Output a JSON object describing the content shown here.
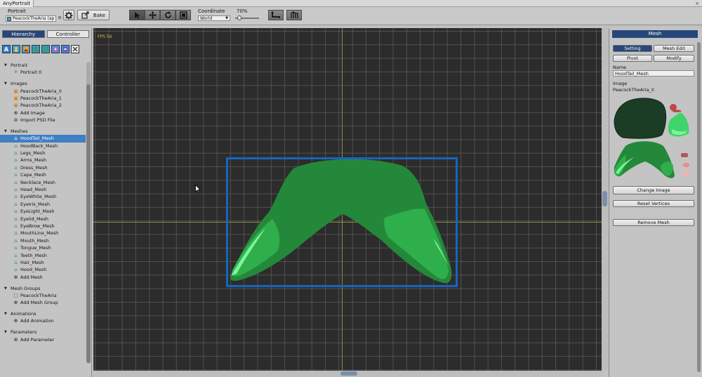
{
  "window": {
    "tab_title": "AnyPortrait",
    "close_label": "×"
  },
  "toolbar": {
    "portrait_label": "Portrait",
    "portrait_value": "PeacockTheAria (ap",
    "portrait_dot": "o",
    "bake_label": "Bake",
    "coordinate_label": "Coordinate",
    "coordinate_value": "World",
    "zoom_label": "70%",
    "zoom_value": 0.7
  },
  "left_panel": {
    "tabs": [
      "Hierarchy",
      "Controller"
    ],
    "filter_icons": [
      "text-filter-icon",
      "bone-filter-icon",
      "image-filter-icon",
      "mesh-filter-icon",
      "meshgroup-filter-icon",
      "animation-filter-icon",
      "param-filter-icon",
      "close-filter-icon"
    ],
    "sections": [
      {
        "title": "Portrait",
        "items": [
          {
            "label": "Portrait 0",
            "icon": "portrait-icon"
          }
        ]
      },
      {
        "title": "Images",
        "items": [
          {
            "label": "PeacockTheAria_0",
            "icon": "image-icon"
          },
          {
            "label": "PeacockTheAria_1",
            "icon": "image-icon"
          },
          {
            "label": "PeacockTheAria_2",
            "icon": "image-icon"
          },
          {
            "label": "Add Image",
            "icon": "add-icon"
          },
          {
            "label": "Import PSD File",
            "icon": "import-icon"
          }
        ]
      },
      {
        "title": "Meshes",
        "items": [
          {
            "label": "HoodTail_Mesh",
            "icon": "mesh-icon",
            "selected": true
          },
          {
            "label": "HoodBack_Mesh",
            "icon": "mesh-icon"
          },
          {
            "label": "Legs_Mesh",
            "icon": "mesh-icon"
          },
          {
            "label": "Arms_Mesh",
            "icon": "mesh-icon"
          },
          {
            "label": "Dress_Mesh",
            "icon": "mesh-icon"
          },
          {
            "label": "Cape_Mesh",
            "icon": "mesh-icon"
          },
          {
            "label": "Necklace_Mesh",
            "icon": "mesh-icon"
          },
          {
            "label": "Head_Mesh",
            "icon": "mesh-icon"
          },
          {
            "label": "EyeWhite_Mesh",
            "icon": "mesh-icon"
          },
          {
            "label": "EyeIris_Mesh",
            "icon": "mesh-icon"
          },
          {
            "label": "EyeLight_Mesh",
            "icon": "mesh-icon"
          },
          {
            "label": "Eyelid_Mesh",
            "icon": "mesh-icon"
          },
          {
            "label": "EyeBrow_Mesh",
            "icon": "mesh-icon"
          },
          {
            "label": "MouthLine_Mesh",
            "icon": "mesh-icon"
          },
          {
            "label": "Mouth_Mesh",
            "icon": "mesh-icon"
          },
          {
            "label": "Tongue_Mesh",
            "icon": "mesh-icon"
          },
          {
            "label": "Teeth_Mesh",
            "icon": "mesh-icon"
          },
          {
            "label": "Hair_Mesh",
            "icon": "mesh-icon"
          },
          {
            "label": "Hood_Mesh",
            "icon": "mesh-icon"
          },
          {
            "label": "Add Mesh",
            "icon": "add-icon"
          }
        ]
      },
      {
        "title": "Mesh Groups",
        "items": [
          {
            "label": "PeacockTheAria",
            "icon": "meshgroup-icon"
          },
          {
            "label": "Add Mesh Group",
            "icon": "add-icon"
          }
        ]
      },
      {
        "title": "Animations",
        "items": [
          {
            "label": "Add Animation",
            "icon": "add-icon"
          }
        ]
      },
      {
        "title": "Parameters",
        "items": [
          {
            "label": "Add Parameter",
            "icon": "add-icon"
          }
        ]
      }
    ]
  },
  "viewport": {
    "fps_label": "FPS 56"
  },
  "right_panel": {
    "header": "Mesh",
    "tab_setting": "Setting",
    "tab_mesh_edit": "Mesh Edit",
    "pivot_label": "Pivot",
    "modify_label": "Modify",
    "name_label": "Name",
    "name_value": "HoodTail_Mesh",
    "image_label": "Image",
    "image_value": "PeacockTheAria_0",
    "change_image": "Change Image",
    "reset_vertices": "Reset Vertices",
    "remove_mesh": "Remove Mesh"
  },
  "colors": {
    "accent": "#27477a",
    "selection": "#3f7fc4",
    "mesh_box": "#1565c0",
    "mesh_fill": "#24883a"
  }
}
